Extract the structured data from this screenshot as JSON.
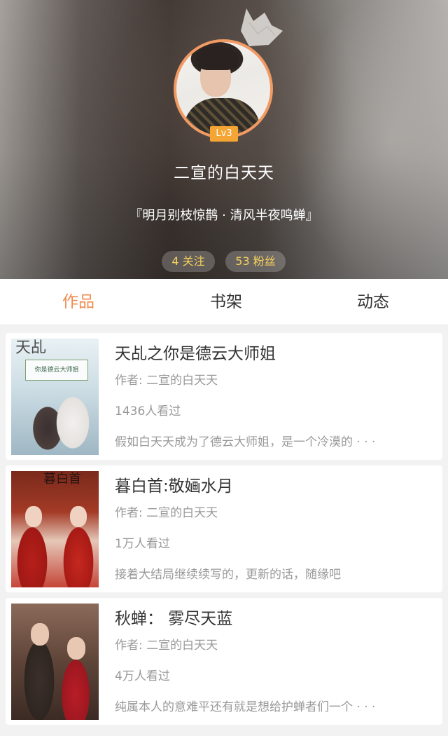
{
  "profile": {
    "level": "Lv3",
    "nickname": "二宣的白天天",
    "signature": "『明月别枝惊鹊 · 清风半夜鸣蝉』",
    "follow_label": "4 关注",
    "fans_label": "53 粉丝",
    "badge_color": "#f4a533",
    "avatar_ring_color": "#f19a63",
    "stat_color": "#f7d25a"
  },
  "tabs": [
    {
      "label": "作品",
      "active": true
    },
    {
      "label": "书架",
      "active": false
    },
    {
      "label": "动态",
      "active": false
    }
  ],
  "accent_color": "#f08b4d",
  "works": [
    {
      "title": "天乩之你是德云大师姐",
      "author": "作者: 二宣的白天天",
      "views": "1436人看过",
      "description": "假如白天天成为了德云大师姐，是一个冷漠的 · · ·",
      "cover_text": "天乩",
      "cover_subtext": "你是德云大师姐"
    },
    {
      "title": "暮白首:敬婳水月",
      "author": "作者: 二宣的白天天",
      "views": "1万人看过",
      "description": "接着大结局继续续写的，更新的话，随缘吧",
      "cover_text": "暮白首"
    },
    {
      "title": "秋蝉：  雾尽天蓝",
      "author": "作者: 二宣的白天天",
      "views": "4万人看过",
      "description": "纯属本人的意难平还有就是想给护蝉者们一个 · · ·"
    }
  ]
}
